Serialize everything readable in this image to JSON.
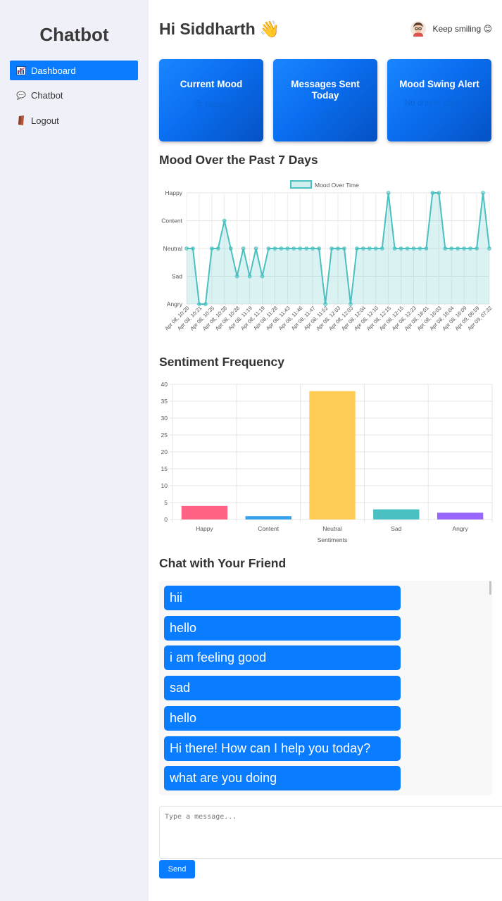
{
  "app": {
    "brand": "Chatbot"
  },
  "sidebar": {
    "items": [
      {
        "label": "Dashboard",
        "icon": "chart-icon",
        "active": true
      },
      {
        "label": "Chatbot",
        "icon": "speech-bubble-icon",
        "active": false
      },
      {
        "label": "Logout",
        "icon": "door-icon",
        "active": false
      }
    ]
  },
  "header": {
    "greeting": "Hi Siddharth",
    "wave": "👋",
    "tagline": "Keep smiling 😊"
  },
  "cards": [
    {
      "title": "Current Mood",
      "value": "😊 Happy"
    },
    {
      "title": "Messages Sent Today",
      "value": "15"
    },
    {
      "title": "Mood Swing Alert",
      "value": "No drastic changes"
    }
  ],
  "mood_section": {
    "title": "Mood Over the Past 7 Days"
  },
  "sentiment_section": {
    "title": "Sentiment Frequency"
  },
  "chat_section": {
    "title": "Chat with Your Friend"
  },
  "chat": {
    "messages": [
      "hii",
      "hello",
      "i am feeling good",
      "sad",
      "hello",
      "Hi there! How can I help you today?",
      "what are you doing"
    ],
    "input_placeholder": "Type a message...",
    "send_label": "Send"
  },
  "colors": {
    "accent": "#0a7cff",
    "line": "#4bc0c0",
    "bars": [
      "#ff6384",
      "#36a2eb",
      "#ffcd56",
      "#4bc0c0",
      "#9966ff"
    ]
  },
  "chart_data": [
    {
      "type": "line",
      "legend": "Mood Over Time",
      "y_categories": [
        "Angry",
        "Sad",
        "Neutral",
        "Content",
        "Happy"
      ],
      "x_tick_labels": [
        "Apr 08, 10:20",
        "Apr 08, 10:21",
        "Apr 08, 10:35",
        "Apr 08, 10:38",
        "Apr 08, 10:38",
        "Apr 08, 11:19",
        "Apr 08, 11:19",
        "Apr 08, 11:28",
        "Apr 08, 11:43",
        "Apr 08, 11:46",
        "Apr 08, 11:47",
        "Apr 08, 11:52",
        "Apr 08, 12:03",
        "Apr 08, 12:03",
        "Apr 08, 12:04",
        "Apr 08, 12:10",
        "Apr 08, 12:15",
        "Apr 08, 12:15",
        "Apr 08, 12:23",
        "Apr 08, 16:01",
        "Apr 08, 16:03",
        "Apr 08, 16:04",
        "Apr 08, 16:09",
        "Apr 09, 06:59",
        "Apr 09, 07:32"
      ],
      "values": [
        "Neutral",
        "Neutral",
        "Angry",
        "Angry",
        "Neutral",
        "Neutral",
        "Content",
        "Neutral",
        "Sad",
        "Neutral",
        "Sad",
        "Neutral",
        "Sad",
        "Neutral",
        "Neutral",
        "Neutral",
        "Neutral",
        "Neutral",
        "Neutral",
        "Neutral",
        "Neutral",
        "Neutral",
        "Angry",
        "Neutral",
        "Neutral",
        "Neutral",
        "Angry",
        "Neutral",
        "Neutral",
        "Neutral",
        "Neutral",
        "Neutral",
        "Happy",
        "Neutral",
        "Neutral",
        "Neutral",
        "Neutral",
        "Neutral",
        "Neutral",
        "Happy",
        "Happy",
        "Neutral",
        "Neutral",
        "Neutral",
        "Neutral",
        "Neutral",
        "Neutral",
        "Happy",
        "Neutral"
      ],
      "grid": true,
      "legend_position": "top"
    },
    {
      "type": "bar",
      "categories": [
        "Happy",
        "Content",
        "Neutral",
        "Sad",
        "Angry"
      ],
      "values": [
        4,
        1,
        38,
        3,
        2
      ],
      "xlabel": "Sentiments",
      "ylim": [
        0,
        40
      ],
      "y_ticks": [
        0,
        5,
        10,
        15,
        20,
        25,
        30,
        35,
        40
      ],
      "grid": true
    }
  ]
}
